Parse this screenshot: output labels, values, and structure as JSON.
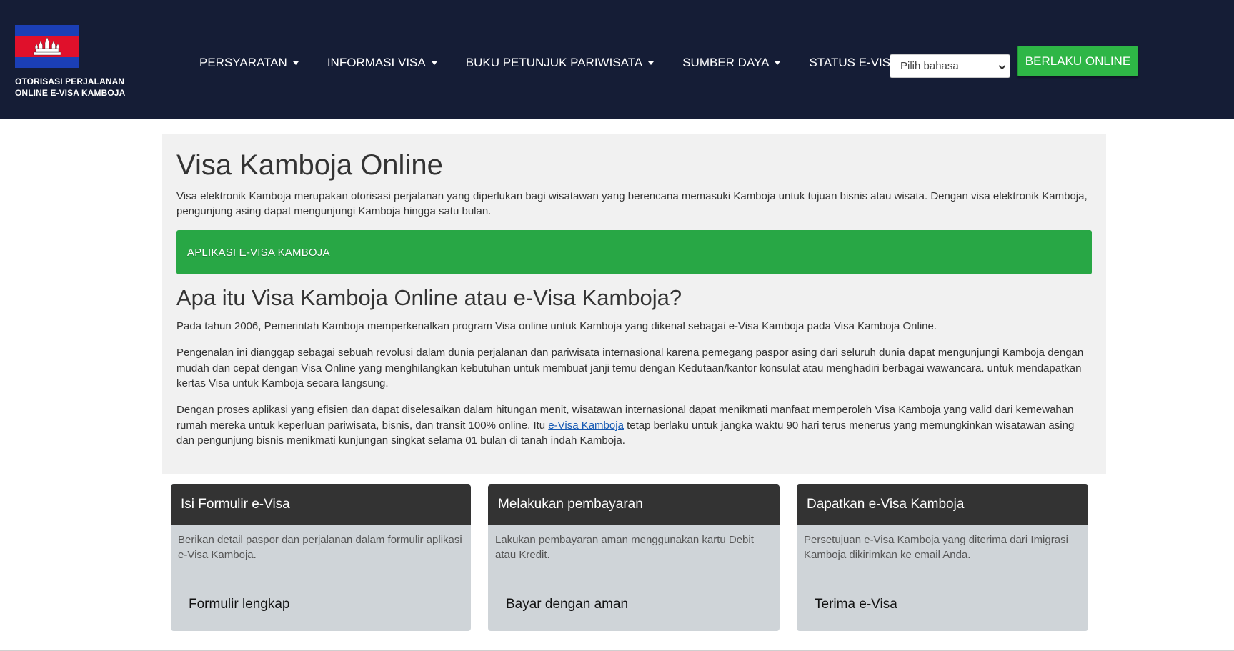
{
  "header": {
    "brand_text": "OTORISASI PERJALANAN ONLINE E-VISA KAMBOJA",
    "nav": [
      {
        "label": "PERSYARATAN",
        "dropdown": true
      },
      {
        "label": "INFORMASI VISA",
        "dropdown": true
      },
      {
        "label": "BUKU PETUNJUK PARIWISATA",
        "dropdown": true
      },
      {
        "label": "SUMBER DAYA",
        "dropdown": true
      },
      {
        "label": "STATUS E-VISA",
        "dropdown": false
      }
    ],
    "language_select": "Pilih bahasa",
    "apply_button": "BERLAKU ONLINE",
    "colors": {
      "background": "#151d36",
      "apply": "#2eb646"
    }
  },
  "main": {
    "title": "Visa Kamboja Online",
    "intro": "Visa elektronik Kamboja merupakan otorisasi perjalanan yang diperlukan bagi wisatawan yang berencana memasuki Kamboja untuk tujuan bisnis atau wisata. Dengan visa elektronik Kamboja, pengunjung asing dapat mengunjungi Kamboja hingga satu bulan.",
    "cta": "APLIKASI E-VISA KAMBOJA",
    "subtitle": "Apa itu Visa Kamboja Online atau e-Visa Kamboja?",
    "p1": "Pada tahun 2006, Pemerintah Kamboja memperkenalkan program Visa online untuk Kamboja yang dikenal sebagai e-Visa Kamboja pada Visa Kamboja Online.",
    "p2": "Pengenalan ini dianggap sebagai sebuah revolusi dalam dunia perjalanan dan pariwisata internasional karena pemegang paspor asing dari seluruh dunia dapat mengunjungi Kamboja dengan mudah dan cepat dengan Visa Online yang menghilangkan kebutuhan untuk membuat janji temu dengan Kedutaan/kantor konsulat atau menghadiri berbagai wawancara. untuk mendapatkan kertas Visa untuk Kamboja secara langsung.",
    "p3_before": "Dengan proses aplikasi yang efisien dan dapat diselesaikan dalam hitungan menit, wisatawan internasional dapat menikmati manfaat memperoleh Visa Kamboja yang valid dari kemewahan rumah mereka untuk keperluan pariwisata, bisnis, dan transit 100% online. Itu ",
    "p3_link": "e-Visa Kamboja",
    "p3_after": " tetap berlaku untuk jangka waktu 90 hari terus menerus yang memungkinkan wisatawan asing dan pengunjung bisnis menikmati kunjungan singkat selama 01 bulan di tanah indah Kamboja."
  },
  "cards": [
    {
      "title": "Isi Formulir e-Visa",
      "body": "Berikan detail paspor dan perjalanan dalam formulir aplikasi e-Visa Kamboja.",
      "link": "Formulir lengkap"
    },
    {
      "title": "Melakukan pembayaran",
      "body": "Lakukan pembayaran aman menggunakan kartu Debit atau Kredit.",
      "link": "Bayar dengan aman"
    },
    {
      "title": "Dapatkan e-Visa Kamboja",
      "body": "Persetujuan e-Visa Kamboja yang diterima dari Imigrasi Kamboja dikirimkan ke email Anda.",
      "link": "Terima e-Visa"
    }
  ]
}
